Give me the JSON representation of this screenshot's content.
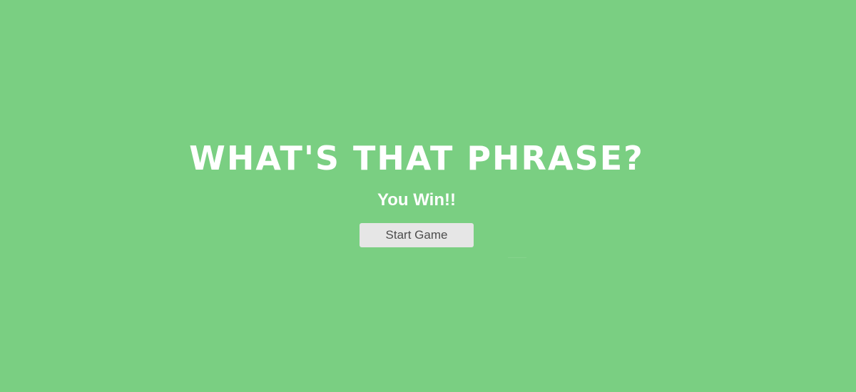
{
  "overlay": {
    "title": "WHAT'S THAT PHRASE?",
    "message": "You Win!!",
    "start_button_label": "Start Game",
    "background_color": "#7acf82"
  }
}
